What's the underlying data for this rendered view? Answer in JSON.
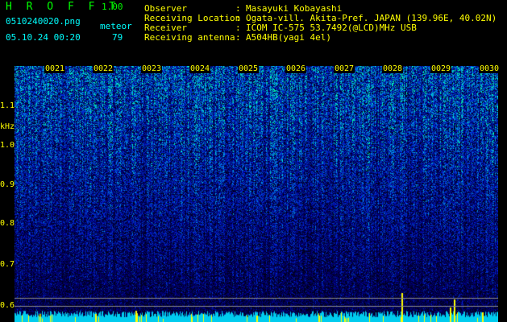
{
  "header": {
    "app_title": "H R O F F T",
    "app_version": "1.00",
    "file_name": "0510240020.png",
    "mode": "meteor",
    "date_time": "05.10.24 00:20",
    "meteor_count": "79"
  },
  "info": [
    {
      "label": "Observer",
      "value": "Masayuki Kobayashi"
    },
    {
      "label": "Receiving Location",
      "value": "Ogata-vill. Akita-Pref. JAPAN (139.96E, 40.02N)"
    },
    {
      "label": "Receiver",
      "value": "ICOM IC-575 53.7492(@LCD)MHz USB"
    },
    {
      "label": "Receiving antenna",
      "value": "A504HB(yagi 4el)"
    }
  ],
  "axis": {
    "y_unit": "kHz",
    "y_ticks": [
      "1.1",
      "1.0",
      "0.9",
      "0.8",
      "0.7",
      "0.6"
    ],
    "x_ticks": [
      "0021",
      "0022",
      "0023",
      "0024",
      "0025",
      "0026",
      "0027",
      "0028",
      "0029",
      "0030"
    ]
  },
  "colors": {
    "background": "#000000",
    "label": "#ffff00",
    "title": "#00ff00",
    "noise_low": "#000033",
    "noise_high": "#00ccff"
  }
}
